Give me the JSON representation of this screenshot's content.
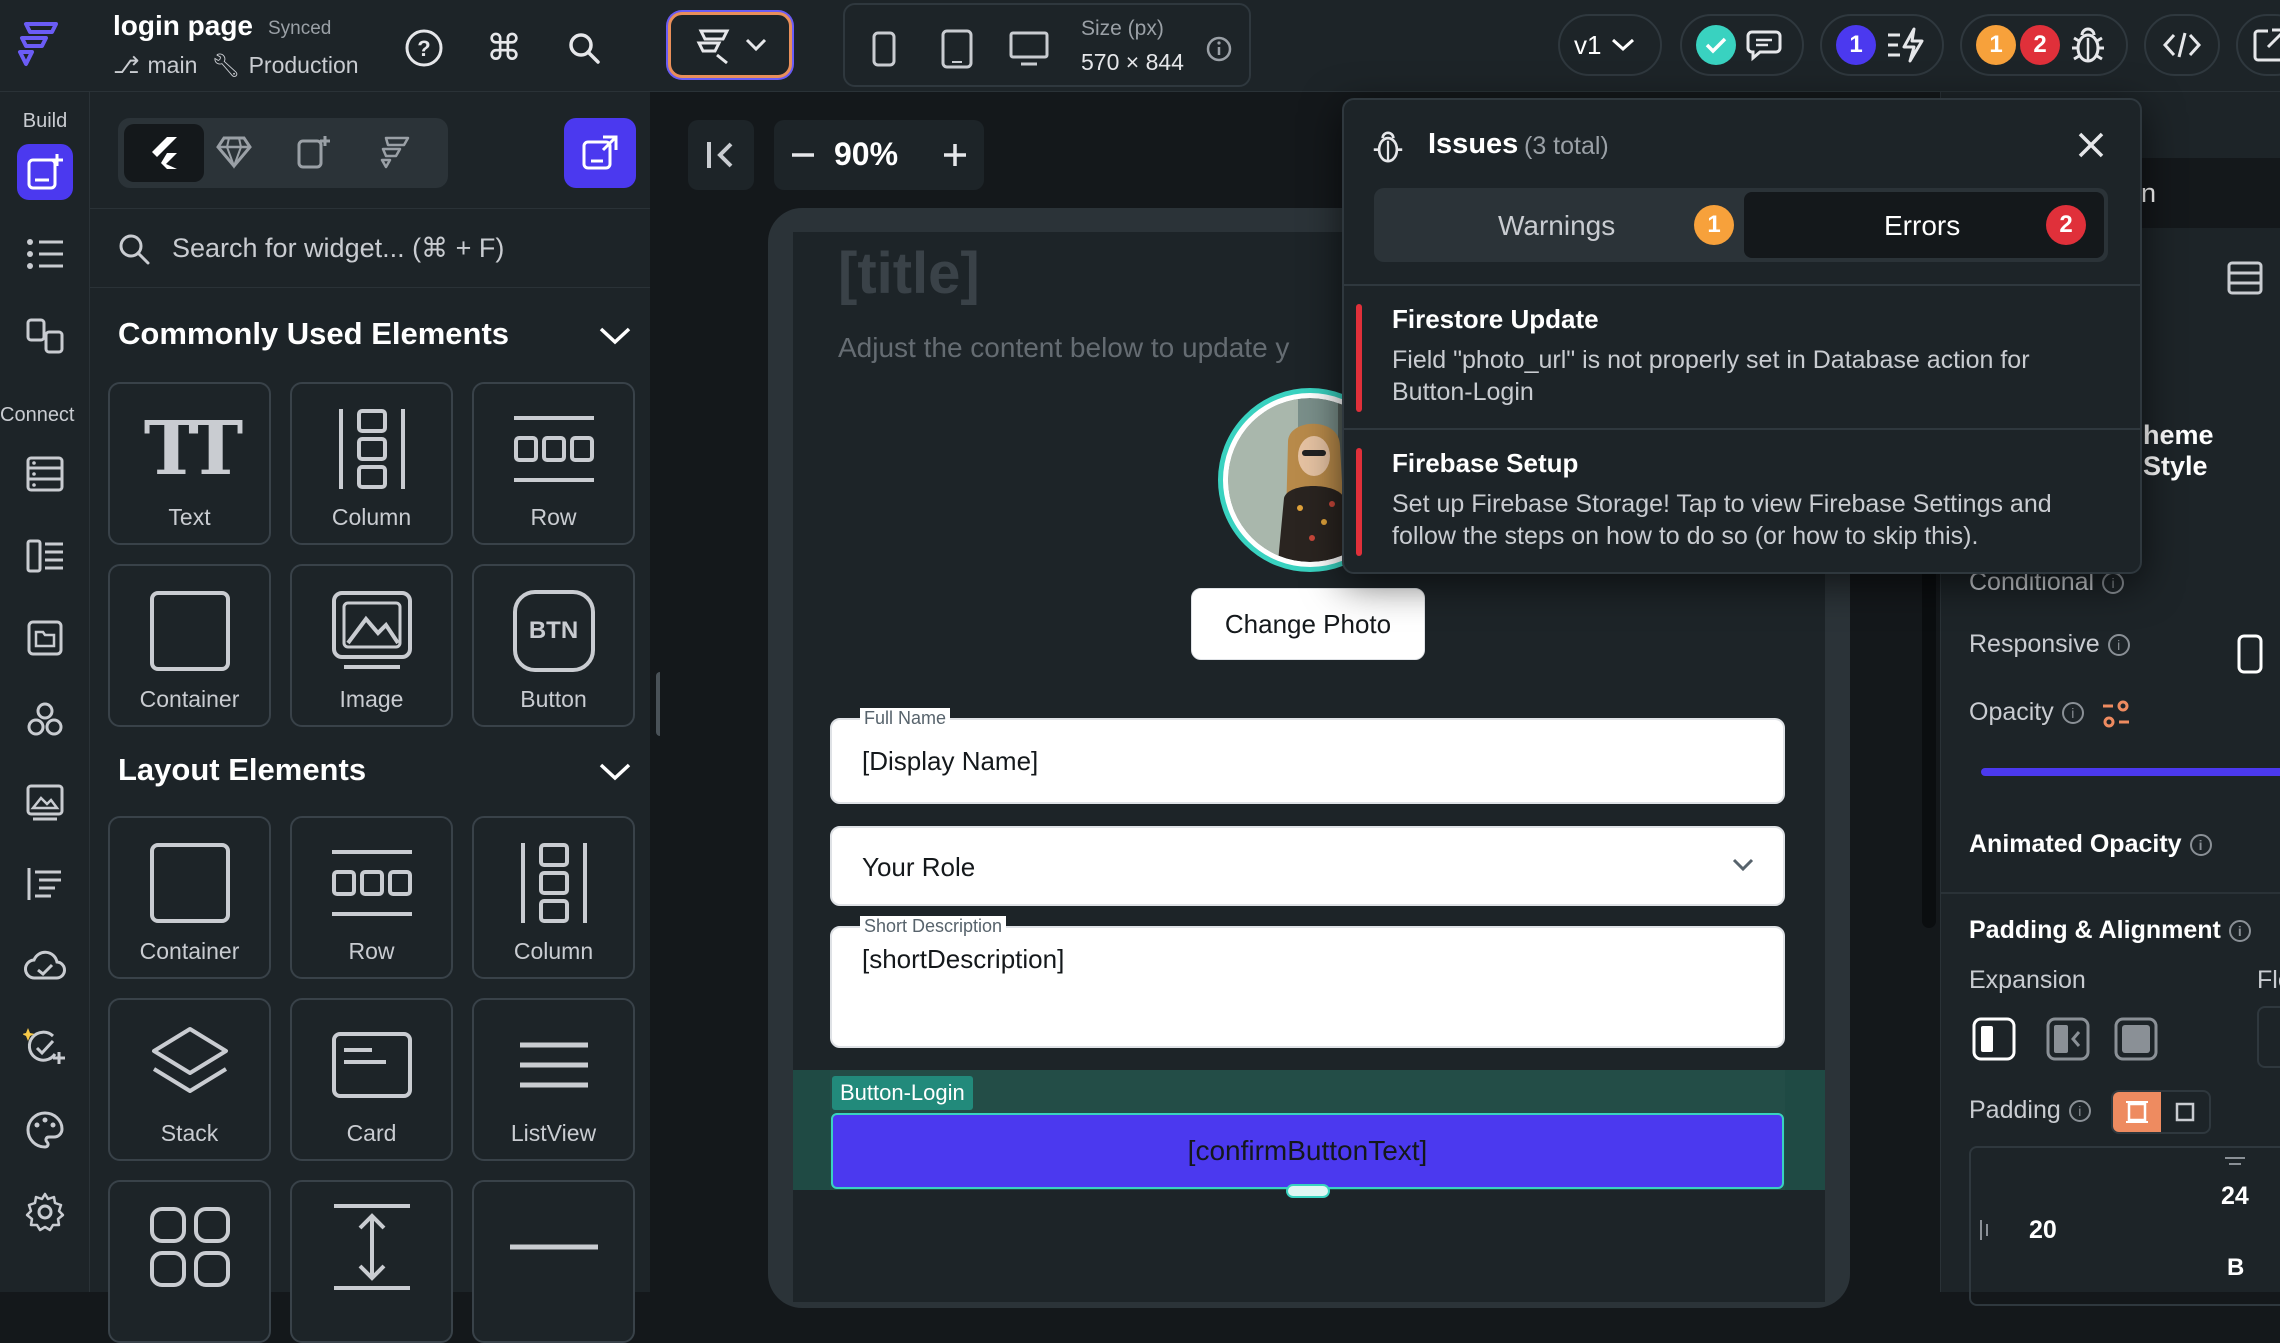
{
  "topbar": {
    "project_title": "login page",
    "sync_status": "Synced",
    "branch": "main",
    "environment": "Production",
    "size_label": "Size (px)",
    "size_value": "570 × 844",
    "version": "v1",
    "badge_blue": "1",
    "badge_orange": "1",
    "badge_red": "2"
  },
  "rail": {
    "build_label": "Build",
    "connect_label": "Connect"
  },
  "panel": {
    "search_placeholder": "Search for widget... (⌘ + F)",
    "common_title": "Commonly Used Elements",
    "common_items": [
      {
        "label": "Text",
        "icon": "text-icon"
      },
      {
        "label": "Column",
        "icon": "column-icon"
      },
      {
        "label": "Row",
        "icon": "row-icon"
      },
      {
        "label": "Container",
        "icon": "container-icon"
      },
      {
        "label": "Image",
        "icon": "image-icon"
      },
      {
        "label": "Button",
        "icon": "button-icon",
        "icon_text": "BTN"
      }
    ],
    "layout_title": "Layout Elements",
    "layout_items": [
      {
        "label": "Container",
        "icon": "container-icon"
      },
      {
        "label": "Row",
        "icon": "row-icon"
      },
      {
        "label": "Column",
        "icon": "column-icon"
      },
      {
        "label": "Stack",
        "icon": "stack-icon"
      },
      {
        "label": "Card",
        "icon": "card-icon"
      },
      {
        "label": "ListView",
        "icon": "listview-icon"
      }
    ]
  },
  "canvas": {
    "zoom": "90%",
    "title_placeholder": "[title]",
    "subtitle": "Adjust the content below to update y",
    "change_photo": "Change Photo",
    "full_name_label": "Full Name",
    "full_name_value": "[Display Name]",
    "role_value": "Your Role",
    "short_desc_label": "Short Description",
    "short_desc_value": "[shortDescription]",
    "button_tag": "Button-Login",
    "confirm_button": "[confirmButtonText]"
  },
  "issues": {
    "title": "Issues",
    "total": "(3 total)",
    "tab_warnings": "Warnings",
    "warnings_count": "1",
    "tab_errors": "Errors",
    "errors_count": "2",
    "items": [
      {
        "title": "Firestore Update",
        "body": "Field \"photo_url\" is not properly set in Database action for Button-Login"
      },
      {
        "title": "Firebase Setup",
        "body": "Set up Firebase Storage! Tap to view Firebase Settings and follow the steps on how to do so (or how to skip this)."
      }
    ]
  },
  "rpanel": {
    "partial_n": "n",
    "theme_style": "heme Style",
    "conditional": "Conditional",
    "responsive": "Responsive",
    "opacity": "Opacity",
    "animated_opacity": "Animated Opacity",
    "padding_alignment": "Padding & Alignment",
    "expansion": "Expansion",
    "fle": "Fle",
    "padding": "Padding",
    "pad_top": "24",
    "pad_left": "20",
    "pad_b": "B"
  },
  "colors": {
    "accent": "#4b39ef",
    "teal": "#39d2c0",
    "orange": "#f7a13b",
    "red": "#e0303a",
    "padding_active": "#ee8b60"
  }
}
